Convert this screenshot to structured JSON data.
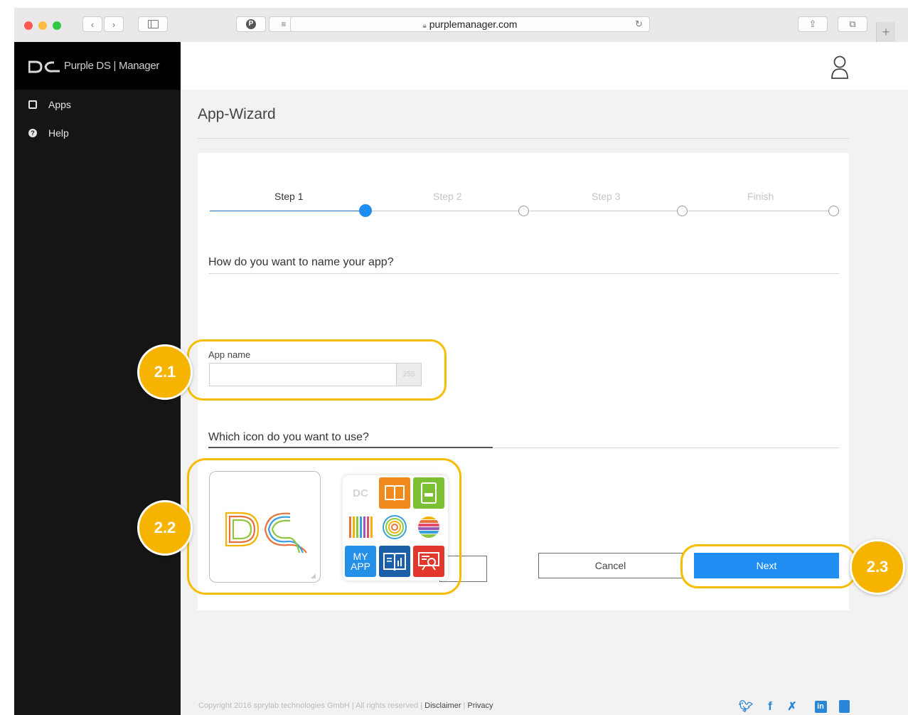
{
  "browser": {
    "url": "purplemanager.com",
    "traffic_lights": [
      "#fc5753",
      "#fdbc40",
      "#33c748"
    ]
  },
  "sidebar": {
    "brand": "Purple DS | Manager",
    "items": [
      {
        "label": "Apps",
        "icon": "tablet-icon"
      },
      {
        "label": "Help",
        "icon": "question-circle-icon"
      }
    ]
  },
  "main": {
    "title": "App-Wizard",
    "steps": [
      {
        "label": "Step 1",
        "state": "active"
      },
      {
        "label": "Step 2",
        "state": "inactive"
      },
      {
        "label": "Step 3",
        "state": "inactive"
      },
      {
        "label": "Finish",
        "state": "inactive"
      }
    ],
    "question_name": "How do you want to name your app?",
    "field_label": "App name",
    "name_value": "",
    "char_counter": "255",
    "question_icon": "Which icon do you want to use?",
    "icon_tiles": [
      {
        "name": "dc-logo-tile",
        "text": "DC"
      },
      {
        "name": "book-tile",
        "text": ""
      },
      {
        "name": "tablet-tile",
        "text": ""
      },
      {
        "name": "stripes-tile",
        "text": ""
      },
      {
        "name": "rings-tile",
        "text": ""
      },
      {
        "name": "striped-circle-tile",
        "text": ""
      },
      {
        "name": "my-app-tile",
        "text": "MY APP"
      },
      {
        "name": "chart-book-tile",
        "text": ""
      },
      {
        "name": "presentation-tile",
        "text": ""
      }
    ],
    "cancel_label": "Cancel",
    "next_label": "Next"
  },
  "annotations": [
    {
      "label": "2.1"
    },
    {
      "label": "2.2"
    },
    {
      "label": "2.3"
    }
  ],
  "footer": {
    "copyright": "Copyright 2016 sprylab technologies GmbH | All rights reserved | ",
    "disclaimer": "Disclaimer",
    "separator": " | ",
    "privacy": "Privacy"
  },
  "colors": {
    "accent": "#1f8df1",
    "callout": "#f6bd00",
    "sidebar_bg": "#151515"
  }
}
